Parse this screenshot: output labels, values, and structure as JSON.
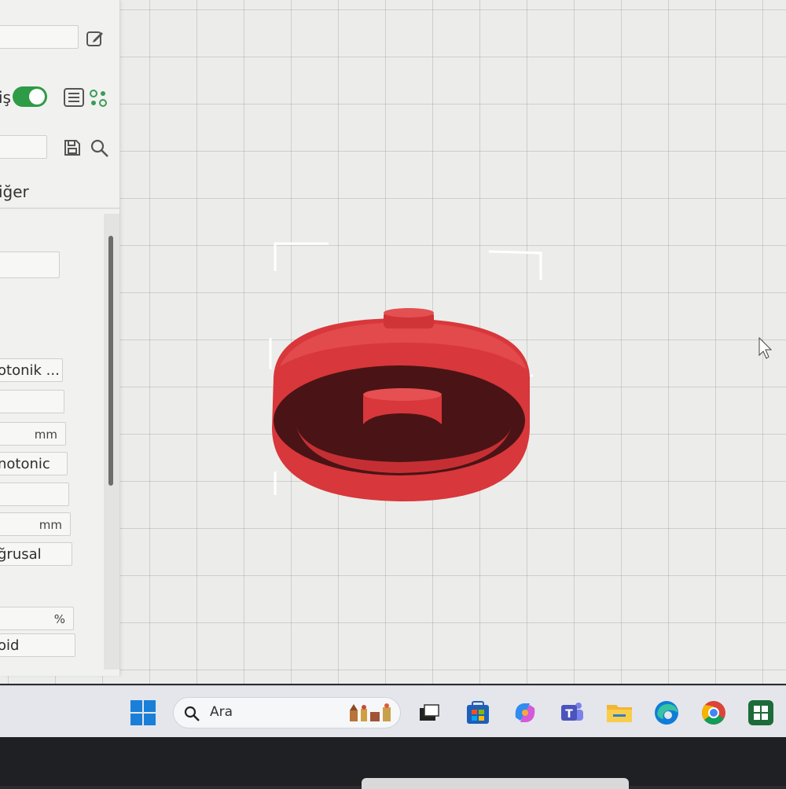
{
  "panel": {
    "toggle_label_fragment": "iş",
    "section_label": "iğer",
    "fields": [
      {
        "text": ""
      },
      {
        "text": "otonik ..."
      },
      {
        "text": ""
      },
      {
        "text": "",
        "unit": "mm"
      },
      {
        "text": "notonic"
      },
      {
        "text": ""
      },
      {
        "text": "",
        "unit": "mm"
      },
      {
        "text": "ğrusal"
      },
      {
        "text": "",
        "unit": "%"
      },
      {
        "text": "oid"
      }
    ]
  },
  "taskbar": {
    "search_placeholder": "Ara"
  },
  "colors": {
    "model_red": "#d8373b",
    "toggle_green": "#2e9b46",
    "grid": "#b4b4b4"
  },
  "icons": [
    "edit-icon",
    "list-icon",
    "settings-icon",
    "save-icon",
    "search-icon",
    "windows-start-icon",
    "widgets-icon",
    "task-view-icon",
    "store-icon",
    "copilot-icon",
    "teams-icon",
    "file-explorer-icon",
    "edge-icon",
    "chrome-icon",
    "slicer-app-icon"
  ]
}
